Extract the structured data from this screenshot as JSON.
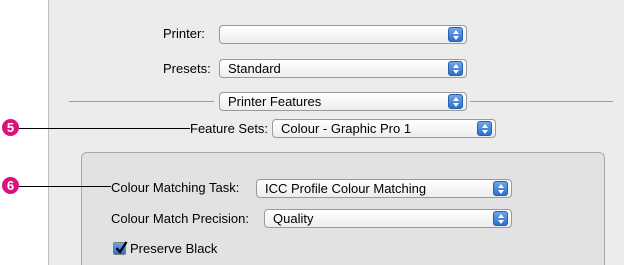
{
  "printer": {
    "label": "Printer:",
    "value": ""
  },
  "presets": {
    "label": "Presets:",
    "value": "Standard"
  },
  "section_menu": {
    "value": "Printer Features"
  },
  "feature_sets": {
    "label": "Feature Sets:",
    "value": "Colour - Graphic Pro 1",
    "callout": "5"
  },
  "colour_matching_task": {
    "label": "Colour Matching Task:",
    "value": "ICC Profile Colour Matching",
    "callout": "6"
  },
  "colour_match_precision": {
    "label": "Colour Match Precision:",
    "value": "Quality"
  },
  "preserve_black": {
    "label": "Preserve Black",
    "checked": true
  },
  "colors": {
    "accent": "#2b6fd0",
    "callout": "#d6147b"
  }
}
